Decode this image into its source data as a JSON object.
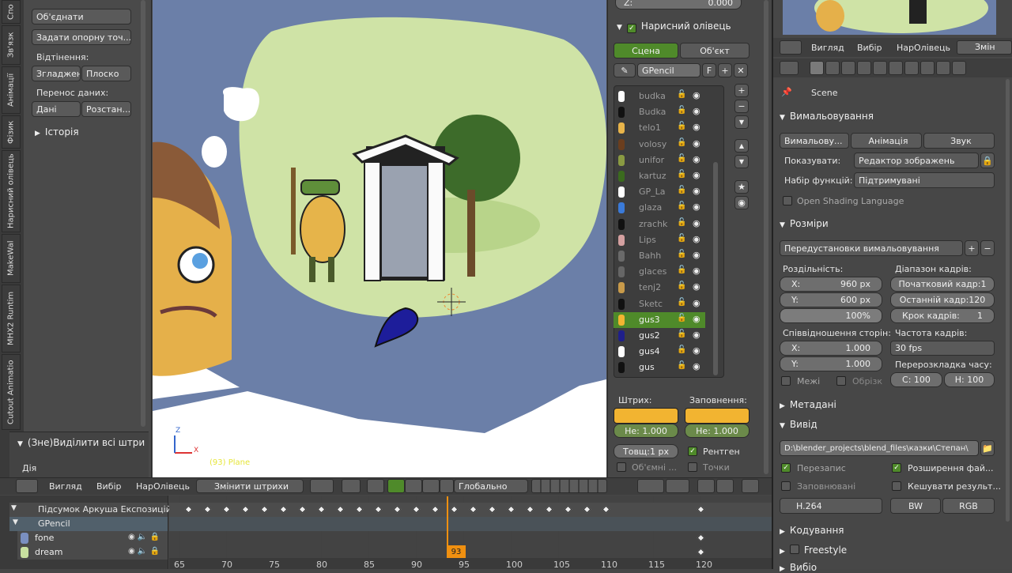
{
  "left_panel": {
    "join_button": "Об'єднати",
    "set_origin_button": "Задати опорну точ...",
    "shading_label": "Відтінення:",
    "smooth_button": "Згладжен",
    "flat_button": "Плоско",
    "data_transfer_label": "Перенос даних:",
    "data_button": "Дані",
    "layout_button": "Розстан...",
    "history_label": "Історія",
    "deselect_label": "(Зне)Виділити всі штри",
    "action_label": "Дія"
  },
  "vertical_tabs": [
    "Спо",
    "Зв'язк",
    "Анімації",
    "Фізик",
    "Нарисний олівець",
    "MakeWal",
    "MHX2 Runtim",
    "Cutout Animatio"
  ],
  "viewport": {
    "info_text": "(93) Plane",
    "axis_x": "X",
    "axis_z": "Z"
  },
  "gpencil_panel": {
    "z_label": "Z:",
    "z_value": "0.000",
    "title": "Нарисний олівець",
    "tab_scene": "Сцена",
    "tab_object": "Об'єкт",
    "data_name": "GPencil",
    "f_label": "F",
    "layers": [
      {
        "name": "budka",
        "color": "#ffffff"
      },
      {
        "name": "Budka",
        "color": "#111111"
      },
      {
        "name": "telo1",
        "color": "#e8b44a"
      },
      {
        "name": "volosy",
        "color": "#6b3e1e"
      },
      {
        "name": "unifor",
        "color": "#8a9a42"
      },
      {
        "name": "kartuz",
        "color": "#3b6b1e"
      },
      {
        "name": "GP_La",
        "color": "#ffffff"
      },
      {
        "name": "glaza",
        "color": "#3a7ad8"
      },
      {
        "name": "zrachk",
        "color": "#111111"
      },
      {
        "name": "Lips",
        "color": "#d4a0a0"
      },
      {
        "name": "Bahh",
        "color": "#6a6a6a"
      },
      {
        "name": "glaces",
        "color": "#666666"
      },
      {
        "name": "tenj2",
        "color": "#c89a4a"
      },
      {
        "name": "Sketc",
        "color": "#111111"
      },
      {
        "name": "gus3",
        "color": "#f2b431"
      },
      {
        "name": "gus2",
        "color": "#1f1f8a"
      },
      {
        "name": "gus4",
        "color": "#ffffff"
      },
      {
        "name": "gus",
        "color": "#111111"
      }
    ],
    "stroke_label": "Штрих:",
    "fill_label": "Заповнення:",
    "stroke_opacity": "Не: 1.000",
    "fill_opacity": "Не: 1.000",
    "thickness": "Товщ:1 px",
    "xray_label": "Рентген",
    "volumetric_label": "Об'ємні ...",
    "points_label": "Точки",
    "stroke_color": "#f2b431",
    "active_color": "#4f8a2a"
  },
  "properties": {
    "view_menu": "Вигляд",
    "select_menu": "Вибір",
    "gpencil_menu": "НарОлівець",
    "edit_menu": "Змін",
    "scene_label": "Scene",
    "render_section": "Вимальовування",
    "render_tab": "Вимальову...",
    "animation_tab": "Анімація",
    "sound_tab": "Звук",
    "display_label": "Показувати:",
    "display_value": "Редактор зображень",
    "feature_set_label": "Набір функцій:",
    "feature_set_value": "Підтримувані",
    "osl_label": "Open Shading Language",
    "dimensions_section": "Розміри",
    "presets_value": "Передустановки вимальовування",
    "resolution_label": "Роздільність:",
    "res_x": "X:",
    "res_x_value": "960 px",
    "res_y": "Y:",
    "res_y_value": "600 px",
    "res_percent": "100%",
    "frame_range_label": "Діапазон кадрів:",
    "start_frame": "Початковий кадр:1",
    "end_frame": "Останній кадр:120",
    "frame_step": "Крок кадрів:",
    "frame_step_value": "1",
    "aspect_label": "Співвідношення сторін:",
    "aspect_x": "X:",
    "aspect_x_value": "1.000",
    "aspect_y": "Y:",
    "aspect_y_value": "1.000",
    "fps_label": "Частота кадрів:",
    "fps_value": "30 fps",
    "time_remap_label": "Перерозкладка часу:",
    "remap_old": "С: 100",
    "remap_new": "Н: 100",
    "border_label": "Межі",
    "crop_label": "Обрізк",
    "metadata_section": "Метадані",
    "output_section": "Вивід",
    "output_path": "D:\\blender_projects\\blend_files\\казки\\Степан\\",
    "overwrite_label": "Перезапис",
    "extensions_label": "Розширення фай...",
    "placeholders_label": "Заповнювані",
    "cache_label": "Кешувати результ...",
    "codec_value": "H.264",
    "bw_button": "BW",
    "rgb_button": "RGB",
    "encoding_section": "Кодування",
    "freestyle_section": "Freestyle",
    "bake_section": "Вибіо"
  },
  "bottom_header": {
    "view_menu": "Вигляд",
    "select_menu": "Вибір",
    "gpencil_menu": "НарОлівець",
    "mode_value": "Змінити штрихи",
    "global_value": "Глобально"
  },
  "dopesheet": {
    "summary_label": "Підсумок Аркуша Експозицій",
    "gpencil_label": "GPencil",
    "channels": [
      {
        "name": "fone",
        "color": "#7a8fc0"
      },
      {
        "name": "dream",
        "color": "#c8e0a0"
      }
    ],
    "current_frame": "93",
    "ticks": [
      "65",
      "70",
      "75",
      "80",
      "85",
      "90",
      "95",
      "100",
      "105",
      "110",
      "115",
      "120"
    ],
    "summary_keyframes": [
      66,
      68,
      70,
      72,
      74,
      76,
      78,
      80,
      82,
      84,
      86,
      88,
      90,
      92,
      94,
      96,
      98,
      100,
      102,
      104,
      106,
      108,
      110,
      120
    ],
    "fone_keyframes": [
      120
    ],
    "dream_keyframes": [
      120
    ]
  }
}
